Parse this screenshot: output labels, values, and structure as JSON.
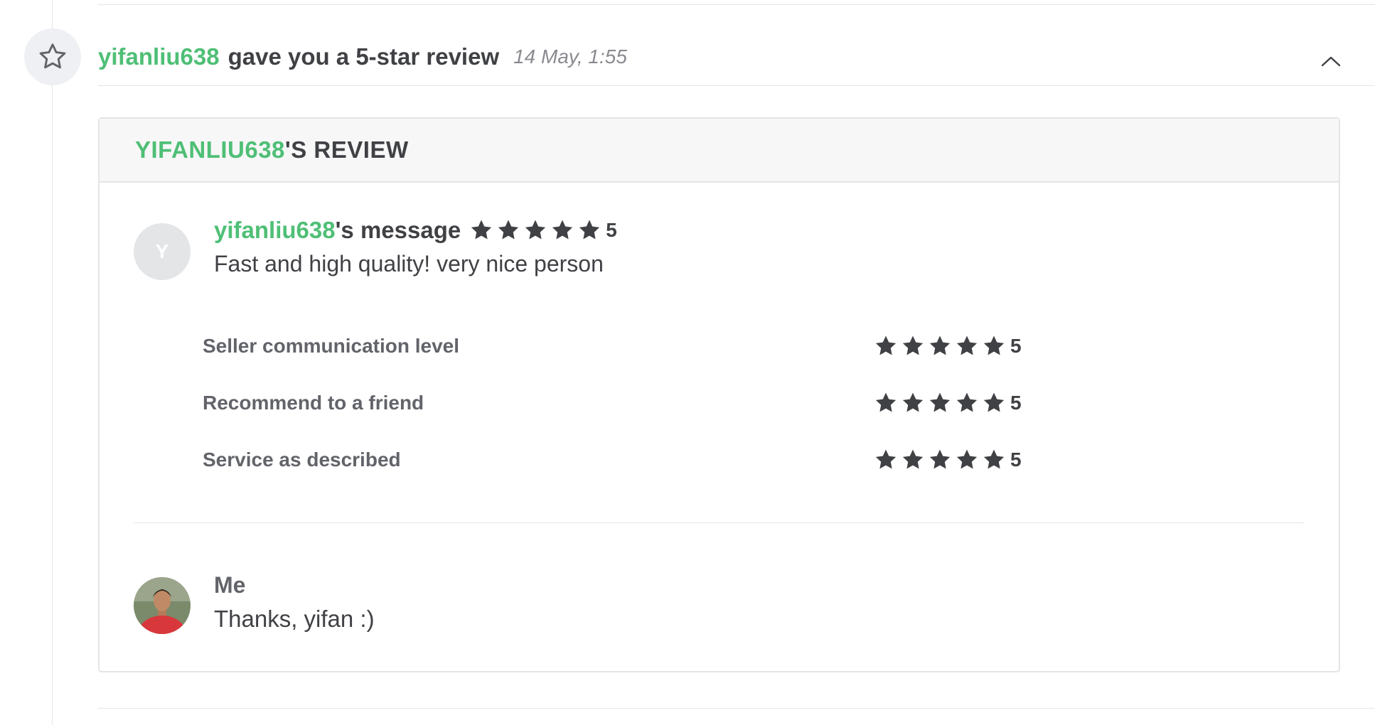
{
  "event": {
    "icon": "star-outline-icon",
    "username": "yifanliu638",
    "action_text": "gave you a 5-star review",
    "timestamp": "14 May, 1:55",
    "collapse_icon": "chevron-up-icon"
  },
  "review_card": {
    "heading_user": "YIFANLIU638",
    "heading_suffix": "'S REVIEW",
    "reviewer": {
      "avatar_letter": "Y",
      "username": "yifanliu638",
      "title_suffix": "'s message",
      "overall_rating": 5,
      "overall_rating_label": "5",
      "message": "Fast and high quality! very nice person"
    },
    "criteria": [
      {
        "label": "Seller communication level",
        "rating": 5,
        "rating_label": "5"
      },
      {
        "label": "Recommend to a friend",
        "rating": 5,
        "rating_label": "5"
      },
      {
        "label": "Service as described",
        "rating": 5,
        "rating_label": "5"
      }
    ],
    "reply": {
      "name": "Me",
      "message": "Thanks, yifan :)"
    }
  },
  "colors": {
    "accent_green": "#4fbf76",
    "text_dark": "#404145",
    "star": "#404145"
  }
}
